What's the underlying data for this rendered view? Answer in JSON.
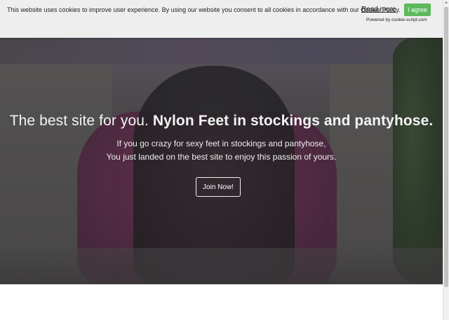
{
  "cookie_bar": {
    "message": "This website uses cookies to improve user experience. By using our website you consent to all cookies in accordance with our Cookie Policy.",
    "read_more_label": "Read more",
    "agree_label": "I agree",
    "powered_by": "Powered by cookie-script.com",
    "agree_color": "#5cb85c"
  },
  "hero": {
    "title_light": "The best site for you.",
    "title_bold": "Nylon Feet in stockings and pantyhose.",
    "line1": "If you go crazy for sexy feet in stockings and pantyhose,",
    "line2": "You just landed on the best site to enjoy this passion of yours.",
    "join_label": "Join Now!"
  }
}
